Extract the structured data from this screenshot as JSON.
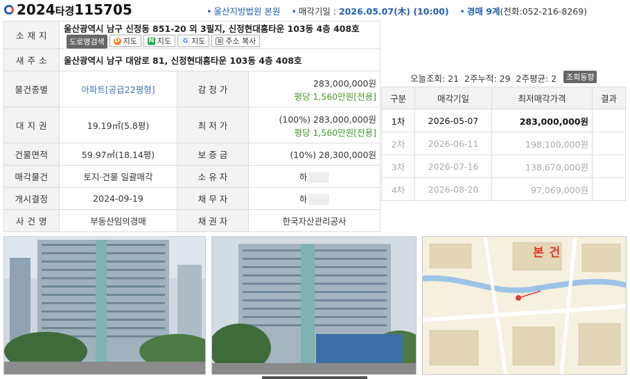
{
  "header": {
    "case_year": "2024",
    "case_type": "타경",
    "case_no": "115705",
    "court": "울산지방법원 본원",
    "sale_date_label": "매각기일 :",
    "sale_date": "2026.05.07(木) (10:00)",
    "dept": "경매 9계",
    "phone": "(전화:052-216-8269)"
  },
  "property": {
    "location_label": "소 재 지",
    "location": "울산광역시 남구 신정동 851-20 외 3필지, 신정현대홈타운 103동 4층 408호",
    "road_search": "도로명검색",
    "map_daum": "지도",
    "map_naver": "지도",
    "map_google": "지도",
    "copy_address": "주소 복사",
    "new_address_label": "새 주 소",
    "new_address": "울산광역시 남구 대암로 81, 신정현대홈타운 103동 4층 408호",
    "type_label": "물건종별",
    "type": "아파트[공급22평형]",
    "appraisal_label": "감 정 가",
    "appraisal": "283,000,000원",
    "appraisal_per": "평당 1,560만원[전용]",
    "land_label": "대 지 권",
    "land": "19.19㎡(5.8평)",
    "min_price_label": "최 저 가",
    "min_price": "(100%) 283,000,000원",
    "min_price_per": "평당 1,560만원[전용]",
    "building_label": "건물면적",
    "building": "59.97㎡(18.14평)",
    "deposit_label": "보 증 금",
    "deposit": "(10%) 28,300,000원",
    "sale_item_label": "매각물건",
    "sale_item": "토지·건물 일괄매각",
    "owner_label": "소 유 자",
    "owner": "하",
    "start_label": "개시결정",
    "start": "2024-09-19",
    "debtor_label": "채 무 자",
    "debtor": "하",
    "case_name_label": "사 건 명",
    "case_name": "부동산임의경매",
    "creditor_label": "채 권 자",
    "creditor": "한국자산관리공사"
  },
  "stats": {
    "text": "오늘조회: 21  2주누적: 29  2주평균: 2",
    "trend_button": "조회동향"
  },
  "rounds": {
    "headers": [
      "구분",
      "매각기일",
      "최저매각가격",
      "결과"
    ],
    "rows": [
      {
        "round": "1차",
        "date": "2026-05-07",
        "price": "283,000,000원",
        "result": ""
      },
      {
        "round": "2차",
        "date": "2026-06-11",
        "price": "198,100,000원",
        "result": ""
      },
      {
        "round": "3차",
        "date": "2026-07-16",
        "price": "138,670,000원",
        "result": ""
      },
      {
        "round": "4차",
        "date": "2026-08-20",
        "price": "97,069,000원",
        "result": ""
      }
    ]
  },
  "map": {
    "marker": "본건"
  },
  "colors": {
    "accent_blue": "#1f5fb0",
    "green": "#3f9a2a",
    "marker_red": "#e23a2a"
  }
}
